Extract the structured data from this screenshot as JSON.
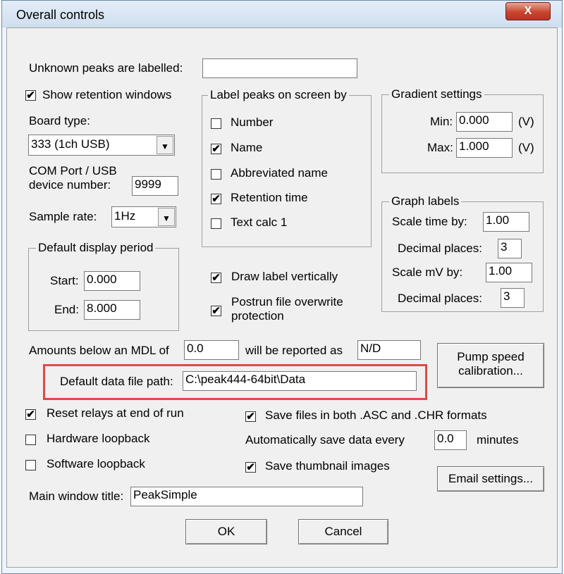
{
  "window": {
    "title": "Overall controls",
    "close_label": "X"
  },
  "unknown_peaks": {
    "label": "Unknown peaks are labelled:",
    "value": ""
  },
  "show_retention": {
    "label": "Show retention windows",
    "checked": true
  },
  "board_type": {
    "label": "Board type:",
    "value": "333 (1ch USB)"
  },
  "com_port": {
    "label_line1": "COM Port / USB",
    "label_line2": "device number:",
    "value": "9999"
  },
  "sample_rate": {
    "label": "Sample rate:",
    "value": "1Hz"
  },
  "display_period": {
    "title": "Default display period",
    "start_label": "Start:",
    "start_value": "0.000",
    "end_label": "End:",
    "end_value": "8.000"
  },
  "label_peaks": {
    "title": "Label peaks on screen by",
    "items": [
      {
        "label": "Number",
        "checked": false
      },
      {
        "label": "Name",
        "checked": true
      },
      {
        "label": "Abbreviated name",
        "checked": false
      },
      {
        "label": "Retention time",
        "checked": true
      },
      {
        "label": "Text calc 1",
        "checked": false
      }
    ]
  },
  "gradient": {
    "title": "Gradient settings",
    "min_label": "Min:",
    "min_value": "0.000",
    "min_unit": "(V)",
    "max_label": "Max:",
    "max_value": "1.000",
    "max_unit": "(V)"
  },
  "graph_labels": {
    "title": "Graph labels",
    "scale_time_label": "Scale time by:",
    "scale_time_value": "1.00",
    "decimal1_label": "Decimal places:",
    "decimal1_value": "3",
    "scale_mv_label": "Scale mV by:",
    "scale_mv_value": "1.00",
    "decimal2_label": "Decimal places:",
    "decimal2_value": "3"
  },
  "draw_vertical": {
    "label": "Draw label vertically",
    "checked": true
  },
  "postrun": {
    "label_line1": "Postrun file overwrite",
    "label_line2": "protection",
    "checked": true
  },
  "mdl": {
    "label": "Amounts below an MDL of",
    "value": "0.0",
    "reported_label": "will be reported as",
    "reported_value": "N/D"
  },
  "pump_button": {
    "line1": "Pump speed",
    "line2": "calibration..."
  },
  "data_path": {
    "label": "Default data file path:",
    "value": "C:\\peak444-64bit\\Data"
  },
  "reset_relays": {
    "label": "Reset relays at end of run",
    "checked": true
  },
  "hardware_loopback": {
    "label": "Hardware loopback",
    "checked": false
  },
  "software_loopback": {
    "label": "Software loopback",
    "checked": false
  },
  "save_both": {
    "label": "Save files in both .ASC and .CHR formats",
    "checked": true
  },
  "autosave": {
    "label": "Automatically save data every",
    "value": "0.0",
    "unit": "minutes"
  },
  "save_thumbs": {
    "label": "Save thumbnail images",
    "checked": true
  },
  "email_button": {
    "label": "Email settings..."
  },
  "main_title": {
    "label": "Main window title:",
    "value": "PeakSimple"
  },
  "ok_button": {
    "label": "OK"
  },
  "cancel_button": {
    "label": "Cancel"
  },
  "check_glyph": "✔",
  "highlight_color": "#e04848"
}
